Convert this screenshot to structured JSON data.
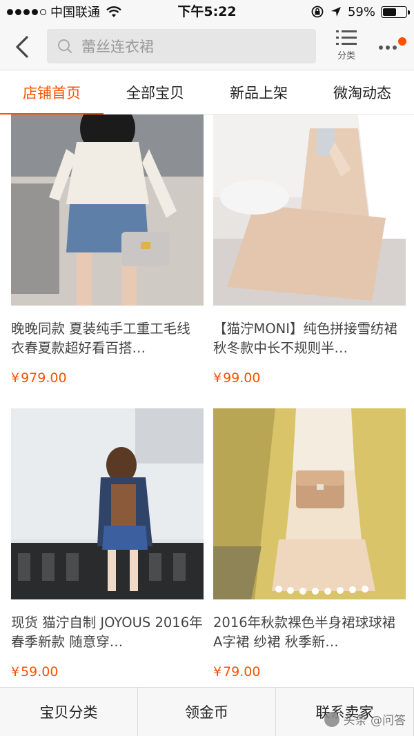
{
  "status_bar": {
    "carrier": "中国联通",
    "time": "下午5:22",
    "battery": "59%",
    "battery_level": 0.59
  },
  "header": {
    "search_placeholder": "蕾丝连衣裙",
    "category_label": "分类"
  },
  "tabs": [
    {
      "label": "店铺首页",
      "active": true
    },
    {
      "label": "全部宝贝",
      "active": false
    },
    {
      "label": "新品上架",
      "active": false
    },
    {
      "label": "微淘动态",
      "active": false
    }
  ],
  "products": [
    {
      "title": "晚晚同款 夏装纯手工重工毛线衣春夏款超好看百搭…",
      "price": "979.00",
      "currency": "¥"
    },
    {
      "title": "【猫泞MONI】纯色拼接雪纺裙秋冬款中长不规则半…",
      "price": "99.00",
      "currency": "¥"
    },
    {
      "title": "现货  猫泞自制  JOYOUS 2016年春季新款 随意穿…",
      "price": "59.00",
      "currency": "¥"
    },
    {
      "title": "2016年秋款裸色半身裙球球裙 A字裙 纱裙 秋季新…",
      "price": "79.00",
      "currency": "¥"
    }
  ],
  "bottom_bar": {
    "items": [
      "宝贝分类",
      "领金币",
      "联系卖家"
    ]
  },
  "watermark": "头条 @问答"
}
